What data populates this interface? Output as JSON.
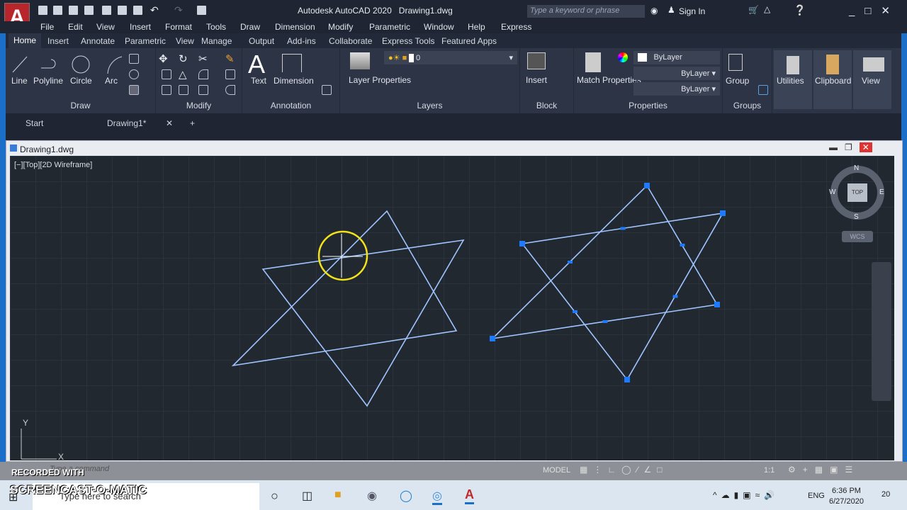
{
  "app": {
    "title": "Autodesk AutoCAD 2020",
    "file": "Drawing1.dwg",
    "logo": "A",
    "search_placeholder": "Type a keyword or phrase",
    "sign_in": "Sign In"
  },
  "menu": [
    "File",
    "Edit",
    "View",
    "Insert",
    "Format",
    "Tools",
    "Draw",
    "Dimension",
    "Modify",
    "Parametric",
    "Window",
    "Help",
    "Express"
  ],
  "ribbon_tabs": [
    "Home",
    "Insert",
    "Annotate",
    "Parametric",
    "View",
    "Manage",
    "Output",
    "Add-ins",
    "Collaborate",
    "Express Tools",
    "Featured Apps"
  ],
  "panels": {
    "draw": {
      "title": "Draw",
      "buttons": [
        "Line",
        "Polyline",
        "Circle",
        "Arc"
      ]
    },
    "modify": {
      "title": "Modify"
    },
    "annotation": {
      "title": "Annotation",
      "buttons": [
        "Text",
        "Dimension"
      ]
    },
    "layers": {
      "title": "Layers",
      "button": "Layer Properties",
      "layer": "0"
    },
    "block": {
      "title": "Block",
      "button": "Insert"
    },
    "properties": {
      "title": "Properties",
      "button": "Match Properties",
      "color": "ByLayer",
      "linetype": "ByLayer",
      "lineweight": "ByLayer"
    },
    "groups": {
      "title": "Groups",
      "button": "Group"
    },
    "utilities": "Utilities",
    "clipboard": "Clipboard",
    "view": "View"
  },
  "file_tabs": [
    "Start",
    "Drawing1*"
  ],
  "drawing_window": {
    "title": "Drawing1.dwg",
    "viewport_label": "[−][Top][2D Wireframe]",
    "compass": {
      "n": "N",
      "s": "S",
      "e": "E",
      "w": "W",
      "top": "TOP"
    },
    "wcs": "WCS",
    "ucs_y": "Y",
    "ucs_x": "X"
  },
  "colors": {
    "geometry": "#9fc4ff",
    "grip": "#1e7bff",
    "cursor": "#f2e21a",
    "background": "#212830"
  },
  "command": {
    "placeholder": "Type a command"
  },
  "status": {
    "model": "MODEL",
    "scale": "1:1"
  },
  "watermark": {
    "line1": "RECORDED WITH",
    "line2": "SCREENCAST-O-MATIC"
  },
  "taskbar": {
    "search": "Type here to search",
    "lang": "ENG",
    "time": "6:36 PM",
    "date": "6/27/2020",
    "notifications": "20"
  }
}
